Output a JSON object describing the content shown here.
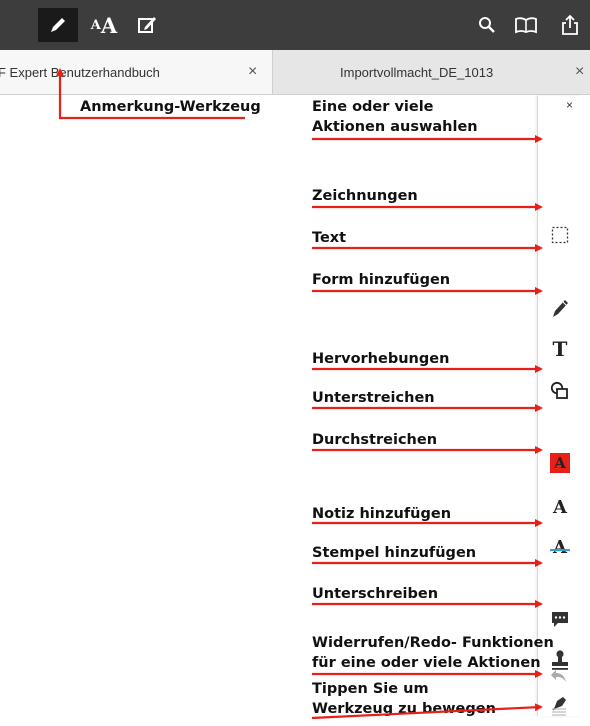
{
  "toolbar": {
    "annotate_icon": "pencil-icon",
    "text_size_label": "AA",
    "edit_icon": "edit-icon",
    "search_icon": "search-icon",
    "book_icon": "book-icon",
    "share_icon": "share-icon"
  },
  "tabs": [
    {
      "label": "F Expert Benutzerhandbuch",
      "close": "×"
    },
    {
      "label": "Importvollmacht_DE_1013",
      "close": "×"
    }
  ],
  "panel": {
    "close": "×",
    "tools": [
      {
        "name": "select-icon"
      },
      {
        "name": "pencil-icon"
      },
      {
        "name": "text-tool-icon",
        "glyph": "T"
      },
      {
        "name": "shape-icon"
      },
      {
        "name": "highlight-icon",
        "glyph": "A",
        "color": "#e8201a"
      },
      {
        "name": "underline-icon",
        "glyph": "A"
      },
      {
        "name": "strikethrough-icon",
        "glyph": "A",
        "color": "#2aa0d8"
      },
      {
        "name": "note-icon"
      },
      {
        "name": "stamp-icon"
      },
      {
        "name": "signature-icon"
      },
      {
        "name": "undo-icon"
      },
      {
        "name": "drag-handle-icon"
      }
    ]
  },
  "annotations": {
    "annotate_tool": "Anmerkung-Werkzeug",
    "select_line1": "Eine oder viele",
    "select_line2": "Aktionen auswahlen",
    "drawings": "Zeichnungen",
    "text": "Text",
    "shape": "Form hinzufügen",
    "highlights": "Hervorhebungen",
    "underline": "Unterstreichen",
    "strikethrough": "Durchstreichen",
    "note": "Notiz hinzufügen",
    "stamp": "Stempel hinzufügen",
    "sign": "Unterschreiben",
    "undo_line1": "Widerrufen/Redo- Funktionen",
    "undo_line2": "für eine oder viele Aktionen",
    "move_line1": "Tippen Sie um",
    "move_line2": "Werkzeug zu bewegen"
  },
  "colors": {
    "toolbar": "#3d3d3d",
    "arrow": "#e8201a",
    "highlight": "#e8201a",
    "strike": "#2aa0d8"
  }
}
